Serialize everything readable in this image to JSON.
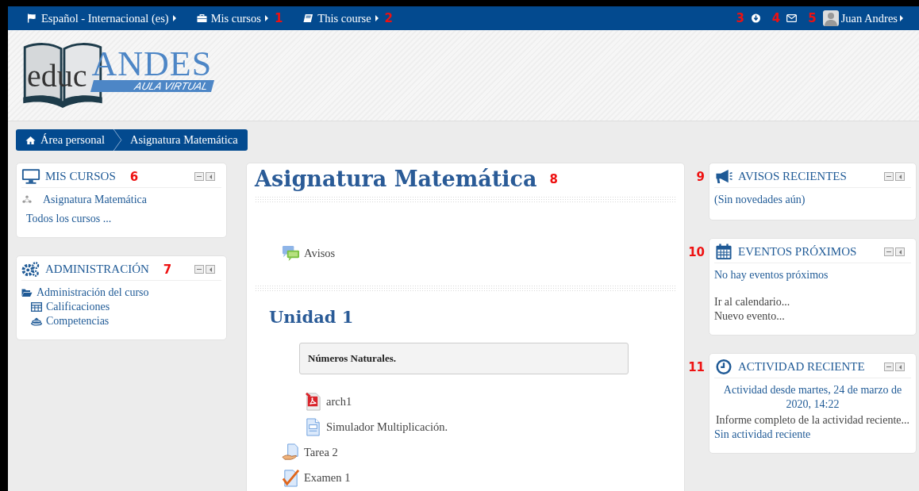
{
  "top_bar": {
    "left": [
      {
        "kind": "flag",
        "label": "Español - Internacional (es)"
      },
      {
        "kind": "briefcase",
        "label": "Mis cursos",
        "marker": "1"
      },
      {
        "kind": "book",
        "label": "This course",
        "marker": "2"
      }
    ],
    "right": [
      {
        "kind": "download",
        "marker": "3"
      },
      {
        "kind": "mail",
        "marker": "4"
      },
      {
        "kind": "user",
        "label": "Juan Andres",
        "marker": "5"
      }
    ]
  },
  "logo": {
    "word": "educ",
    "brand": "ANDES",
    "tagline": "AULA VIRTUAL"
  },
  "breadcrumb": [
    {
      "label": "Área personal",
      "home": true
    },
    {
      "label": "Asignatura Matemática",
      "home": false
    }
  ],
  "left_blocks": [
    {
      "title": "MIS CURSOS",
      "kind": "monitor",
      "marker": "6",
      "items": [
        {
          "kind": "course",
          "label": "Asignatura Matemática"
        },
        {
          "kind": "link",
          "label": "Todos los cursos ..."
        }
      ]
    },
    {
      "title": "ADMINISTRACIÓN",
      "kind": "gears",
      "marker": "7",
      "items": [
        {
          "kind": "tree",
          "label": "Administración del curso",
          "children": [
            {
              "kind": "table",
              "label": "Calificaciones"
            },
            {
              "kind": "layers",
              "label": "Competencias"
            }
          ]
        }
      ]
    }
  ],
  "course": {
    "title": "Asignatura Matemática",
    "marker": "8",
    "sections": [
      {
        "activities": [
          {
            "kind": "forum",
            "label": "Avisos",
            "indented": false
          }
        ]
      },
      {
        "name": "Unidad 1",
        "summary": "Números Naturales.",
        "activities": [
          {
            "kind": "pdf",
            "label": "arch1",
            "indented": true
          },
          {
            "kind": "page",
            "label": "Simulador Multiplicación.",
            "indented": true
          },
          {
            "kind": "assign",
            "label": "Tarea 2",
            "indented": false
          },
          {
            "kind": "quiz",
            "label": "Examen 1",
            "indented": false
          }
        ]
      }
    ]
  },
  "right_blocks": [
    {
      "title": "AVISOS RECIENTES",
      "kind": "megaphone",
      "marker": "9",
      "items": [
        {
          "kind": "link",
          "label": "(Sin novedades aún)"
        }
      ]
    },
    {
      "title": "EVENTOS PRÓXIMOS",
      "kind": "calendar",
      "marker": "10",
      "items": [
        {
          "kind": "link",
          "label": "No hay eventos próximos"
        },
        {
          "kind": "footer",
          "label": "Ir al calendario..."
        },
        {
          "kind": "muted",
          "label": "Nuevo evento..."
        }
      ]
    },
    {
      "title": "ACTIVIDAD RECIENTE",
      "kind": "clock",
      "marker": "11",
      "items": [
        {
          "kind": "center-link",
          "label": "Actividad desde martes, 24 de marzo de 2020, 14:22"
        },
        {
          "kind": "center-muted",
          "label": "Informe completo de la actividad reciente..."
        },
        {
          "kind": "link",
          "label": "Sin actividad reciente"
        }
      ]
    }
  ]
}
